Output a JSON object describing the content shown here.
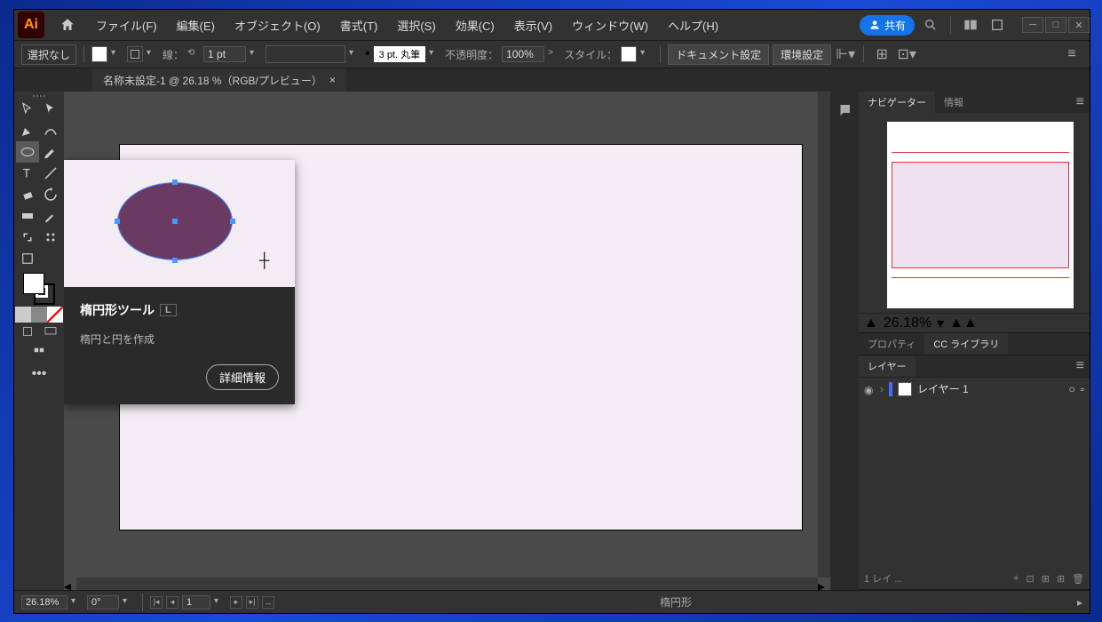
{
  "menu": {
    "file": "ファイル(F)",
    "edit": "編集(E)",
    "object": "オブジェクト(O)",
    "type": "書式(T)",
    "select": "選択(S)",
    "effect": "効果(C)",
    "view": "表示(V)",
    "window": "ウィンドウ(W)",
    "help": "ヘルプ(H)"
  },
  "titlebar": {
    "share": "共有"
  },
  "control": {
    "selection": "選択なし",
    "stroke_label": "線：",
    "stroke_weight": "1 pt",
    "brush_preset": "3 pt. 丸筆",
    "opacity_label": "不透明度：",
    "opacity": "100%",
    "style_label": "スタイル：",
    "doc_setup": "ドキュメント設定",
    "env_setup": "環境設定"
  },
  "tab": {
    "name": "名称未設定-1 @ 26.18 %（RGB/プレビュー）"
  },
  "tooltip": {
    "title": "楕円形ツール",
    "shortcut": "L",
    "desc": "楕円と円を作成",
    "more": "詳細情報"
  },
  "navigator": {
    "tab1": "ナビゲーター",
    "tab2": "情報",
    "zoom": "26.18%"
  },
  "props": {
    "tab1": "プロパティ",
    "tab2": "CC ライブラリ"
  },
  "layers": {
    "tab": "レイヤー",
    "layer1": "レイヤー 1",
    "footer": "1 レイ ..."
  },
  "status": {
    "zoom": "26.18%",
    "rotation": "0°",
    "artboard": "1",
    "tool": "楕円形"
  }
}
